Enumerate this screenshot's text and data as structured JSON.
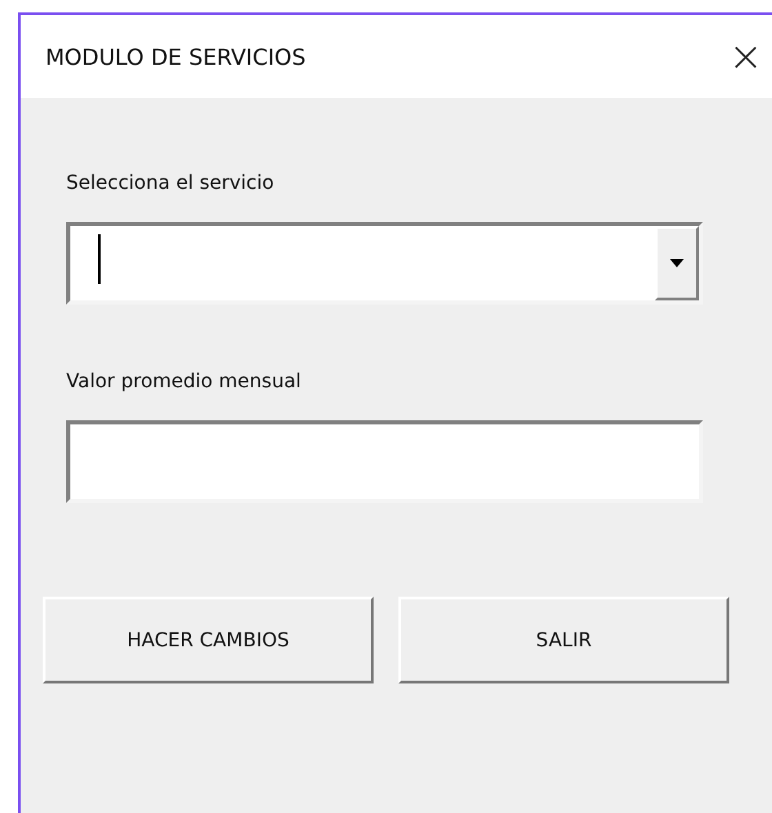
{
  "window": {
    "title": "MODULO DE SERVICIOS",
    "close": "×"
  },
  "fields": [
    {
      "kind": "combo",
      "label": "Selecciona el servicio",
      "focused": true
    },
    {
      "kind": "text",
      "label": "Valor promedio mensual",
      "focused": false
    }
  ],
  "buttons": [
    "HACER CAMBIOS",
    "SALIR"
  ]
}
